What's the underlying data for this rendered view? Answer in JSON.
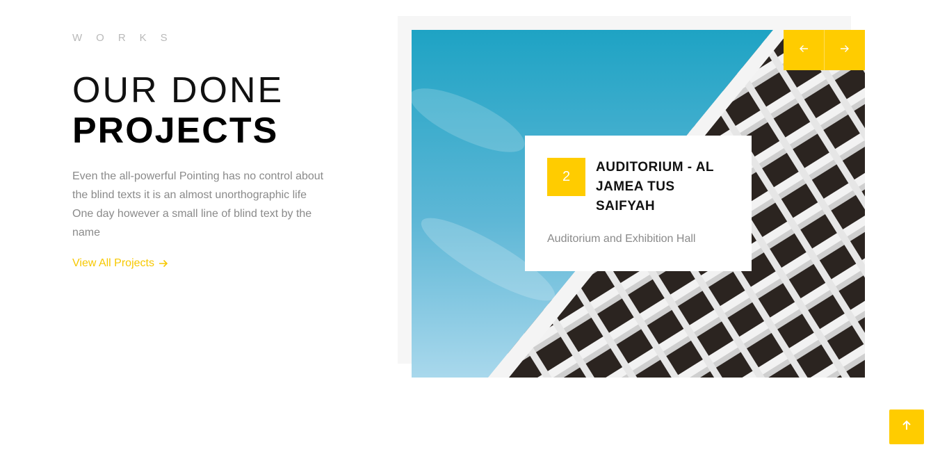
{
  "section": {
    "eyebrow": "WORKS",
    "heading_light": "OUR DONE",
    "heading_bold": "PROJECTS",
    "description": "Even the all-powerful Pointing has no control about the blind texts it is an almost unorthographic life One day however a small line of blind text by the name",
    "view_all_label": "View All Projects"
  },
  "project": {
    "number": "2",
    "title": "AUDITORIUM - AL JAMEA TUS SAIFYAH",
    "subtitle": "Auditorium and Exhibition Hall"
  },
  "icons": {
    "prev": "arrow-left-icon",
    "next": "arrow-right-icon",
    "scroll_top": "arrow-up-icon",
    "view_all": "arrow-right-icon"
  },
  "colors": {
    "accent": "#ffcc00",
    "text_dark": "#111111",
    "text_muted": "#8a8a8a",
    "eyebrow": "#b9b9b9"
  }
}
